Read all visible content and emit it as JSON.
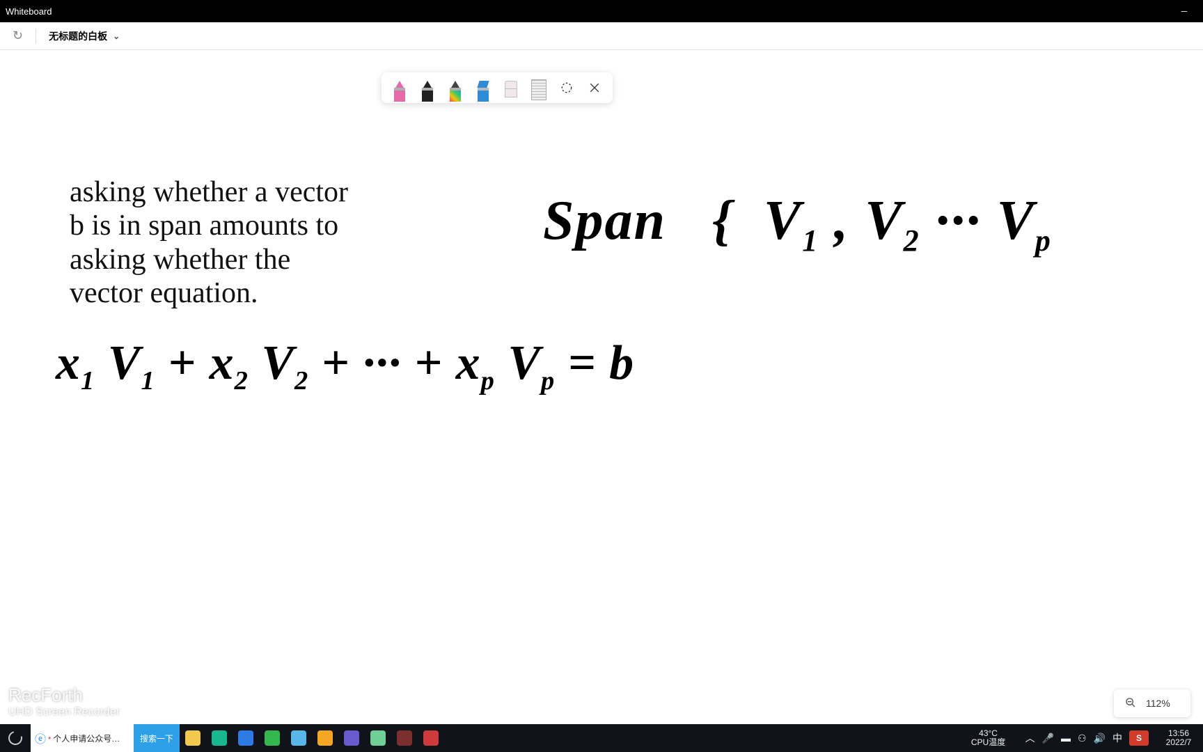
{
  "window": {
    "title": "Whiteboard"
  },
  "header": {
    "redo_icon": "↻",
    "doc_name": "无标题的白板"
  },
  "toolbar": {
    "tools": [
      {
        "name": "pen-pink-icon"
      },
      {
        "name": "pen-black-icon"
      },
      {
        "name": "pen-rainbow-icon"
      },
      {
        "name": "highlighter-blue-icon"
      },
      {
        "name": "eraser-icon"
      },
      {
        "name": "ruler-icon"
      },
      {
        "name": "lasso-select-icon"
      },
      {
        "name": "close-toolbar-icon"
      }
    ]
  },
  "canvas": {
    "typed_text": "asking whether a vector\nb is in span amounts to\nasking whether the\nvector equation.",
    "hand_span_label": "Span",
    "hand_span_set_open": "{",
    "hand_span_v1": "V",
    "hand_span_v1_sub": "1",
    "hand_span_comma1": " , ",
    "hand_span_v2": "V",
    "hand_span_v2_sub": "2",
    "hand_span_dots": " ··· ",
    "hand_span_vp": "V",
    "hand_span_vp_sub": "p",
    "eq_x1": "x",
    "eq_x1_sub": "1",
    "eq_v1": "V",
    "eq_v1_sub": "1",
    "eq_plus1": " + ",
    "eq_x2": "x",
    "eq_x2_sub": "2",
    "eq_v2": "V",
    "eq_v2_sub": "2",
    "eq_plus2": " +   ···   + ",
    "eq_xp": "x",
    "eq_xp_sub": "p",
    "eq_vp": "V",
    "eq_vp_sub": "p",
    "eq_eq": " =   ",
    "eq_b": "b"
  },
  "watermark": {
    "title": "RecForth",
    "sub": "UHD Screen Recorder"
  },
  "zoom": {
    "label": "112%"
  },
  "taskbar": {
    "ie_label": "个人申请公众号…",
    "search_label": "搜索一下",
    "temp_top": "43°C",
    "temp_bottom": "CPU温度",
    "ime": "中",
    "brand": "S",
    "clock_top": "13:56",
    "clock_bottom": "2022/7",
    "tray_up": "︿",
    "icon_colors": {
      "files": "#f2c94c",
      "teal": "#17b890",
      "blue": "#2c7be5",
      "green": "#32b84d",
      "bird": "#58b6e8",
      "orange": "#f5a623",
      "purple": "#6a5acd",
      "wechat": "#6fcf97",
      "rec": "#7d2e2e",
      "cam": "#cf3a3a"
    }
  }
}
